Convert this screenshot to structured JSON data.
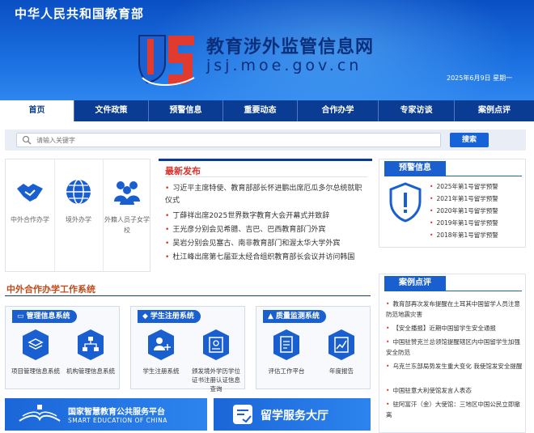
{
  "header": {
    "ministry": "中华人民共和国教育部",
    "site_title": "教育涉外监管信息网",
    "site_url": "jsj.moe.gov.cn",
    "date": "2025年6月9日  星期一"
  },
  "nav": {
    "items": [
      "首页",
      "文件政策",
      "预警信息",
      "重要动态",
      "合作办学",
      "专家访谈",
      "案例点评"
    ],
    "active_index": 0
  },
  "search": {
    "placeholder": "请输入关键字",
    "button_label": "搜索"
  },
  "quick_links": [
    {
      "label": "中外合作办学",
      "icon": "handshake-icon"
    },
    {
      "label": "境外办学",
      "icon": "globe-icon"
    },
    {
      "label": "外籍人员子女学校",
      "icon": "people-icon"
    }
  ],
  "news": {
    "title": "最新发布",
    "items": [
      "习近平主席特使、教育部部长怀进鹏出席厄瓜多尔总统就职仪式",
      "丁薛祥出席2025世界数字教育大会开幕式并致辞",
      "王光彦分别会见希腊、吉巴、巴西教育部门外宾",
      "吴岩分别会见塞古、南非教育部门和渥太华大学外宾",
      "杜江峰出席第七届亚太经合组织教育部长会议并访问韩国"
    ]
  },
  "warning": {
    "title": "预警信息",
    "items": [
      "2025年第1号留学预警",
      "2021年第1号留学预警",
      "2020年第1号留学预警",
      "2019年第1号留学预警",
      "2018年第1号留学预警"
    ]
  },
  "coop": {
    "title": "中外合作办学工作系统",
    "systems": [
      {
        "title": "管理信息系统",
        "icon": "monitor-icon",
        "items": [
          {
            "label": "项目管理信息系统",
            "icon": "layers-icon"
          },
          {
            "label": "机构管理信息系统",
            "icon": "org-chart-icon"
          }
        ]
      },
      {
        "title": "学生注册系统",
        "icon": "grad-cap-icon",
        "items": [
          {
            "label": "学生注册系统",
            "icon": "add-user-icon"
          },
          {
            "label": "颁发境外学历学位证书注册认证信息查询",
            "icon": "certificate-icon"
          }
        ]
      },
      {
        "title": "质量监测系统",
        "icon": "quality-icon",
        "items": [
          {
            "label": "评估工作平台",
            "icon": "clipboard-icon"
          },
          {
            "label": "年度报告",
            "icon": "report-chart-icon"
          }
        ]
      }
    ]
  },
  "banners": {
    "smart_title": "国家智慧教育公共服务平台",
    "smart_subtitle": "SMART EDUCATION OF CHINA",
    "study_title": "留学服务大厅"
  },
  "cases": {
    "title": "案例点评",
    "items": [
      "教育部再次发布提醒在土耳其中国留学人员注意防范地震灾害",
      "【安全播报】近期中国留学生安全通报",
      "中国驻赞克兰总领馆提醒辖区内中国留学生加强安全防范",
      "乌克兰东部局势发生重大变化 我使馆发安全提醒",
      "中国驻意大利使馆发言人表态",
      "驻阿富汗（金）大使馆：三地区中国公民立即撤离"
    ]
  },
  "colors": {
    "primary": "#0b3c93",
    "accent": "#1a5fcf",
    "highlight": "#d9312b"
  }
}
